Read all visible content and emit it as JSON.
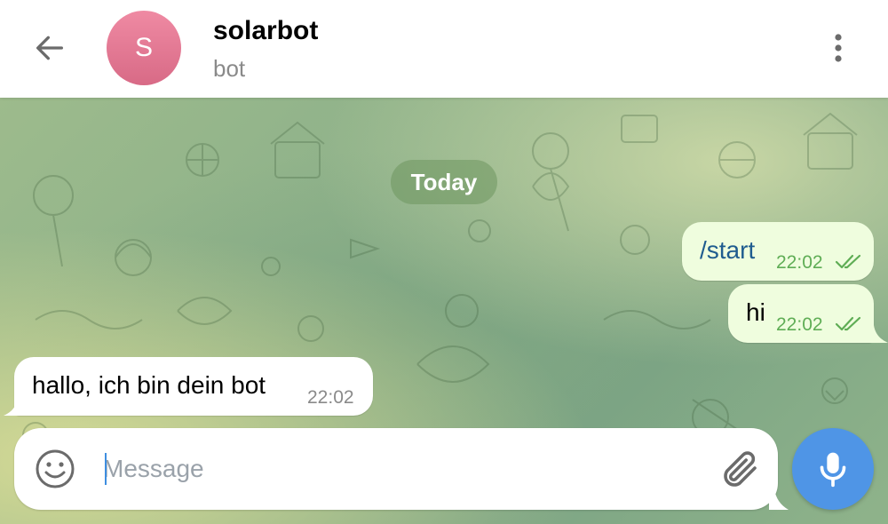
{
  "header": {
    "chat_title": "solarbot",
    "chat_subtitle": "bot",
    "avatar_letter": "S",
    "avatar_color": "#e07a93"
  },
  "chat": {
    "date_divider": "Today",
    "messages": [
      {
        "direction": "outgoing",
        "text": "/start",
        "time": "22:02",
        "status": "read"
      },
      {
        "direction": "outgoing",
        "text": "hi",
        "time": "22:02",
        "status": "read"
      },
      {
        "direction": "incoming",
        "text": "hallo, ich bin dein bot",
        "time": "22:02"
      }
    ]
  },
  "composer": {
    "placeholder": "Message",
    "value": ""
  },
  "icons": {
    "back": "arrow-left-icon",
    "menu": "more-vertical-icon",
    "emoji": "emoji-icon",
    "attach": "paperclip-icon",
    "mic": "microphone-icon"
  },
  "colors": {
    "outgoing_bubble": "#effdde",
    "incoming_bubble": "#ffffff",
    "outgoing_time": "#5fad55",
    "command_link": "#1f5c8f",
    "mic_button": "#4f95e6"
  }
}
